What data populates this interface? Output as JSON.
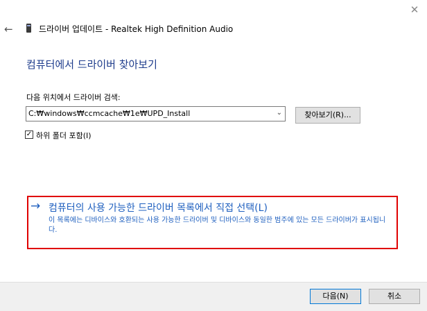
{
  "window": {
    "title": "드라이버 업데이트 - Realtek High Definition Audio",
    "close_glyph": "✕",
    "back_glyph": "←",
    "icons": {
      "close": "close-icon",
      "back": "back-arrow-icon",
      "device": "device-icon"
    }
  },
  "page": {
    "heading": "컴퓨터에서 드라이버 찾아보기"
  },
  "search": {
    "label": "다음 위치에서 드라이버 검색:",
    "path_value": "C:₩windows₩ccmcache₩1e₩UPD_Install",
    "dropdown_glyph": "⌄",
    "browse_label": "찾아보기(R)...",
    "include_subfolders_label": "하위 폴더 포함(I)",
    "include_subfolders_checked": true,
    "check_glyph": "✓"
  },
  "pick_option": {
    "arrow_glyph": "→",
    "title": "컴퓨터의 사용 가능한 드라이버 목록에서 직접 선택(L)",
    "description": "이 목록에는 디바이스와 호환되는 사용 가능한 드라이버 및 디바이스와 동일한 범주에 있는 모든 드라이버가 표시됩니다.",
    "highlight_color": "#e00000",
    "link_color": "#1e5fbf"
  },
  "footer": {
    "next_label": "다음(N)",
    "cancel_label": "취소"
  }
}
